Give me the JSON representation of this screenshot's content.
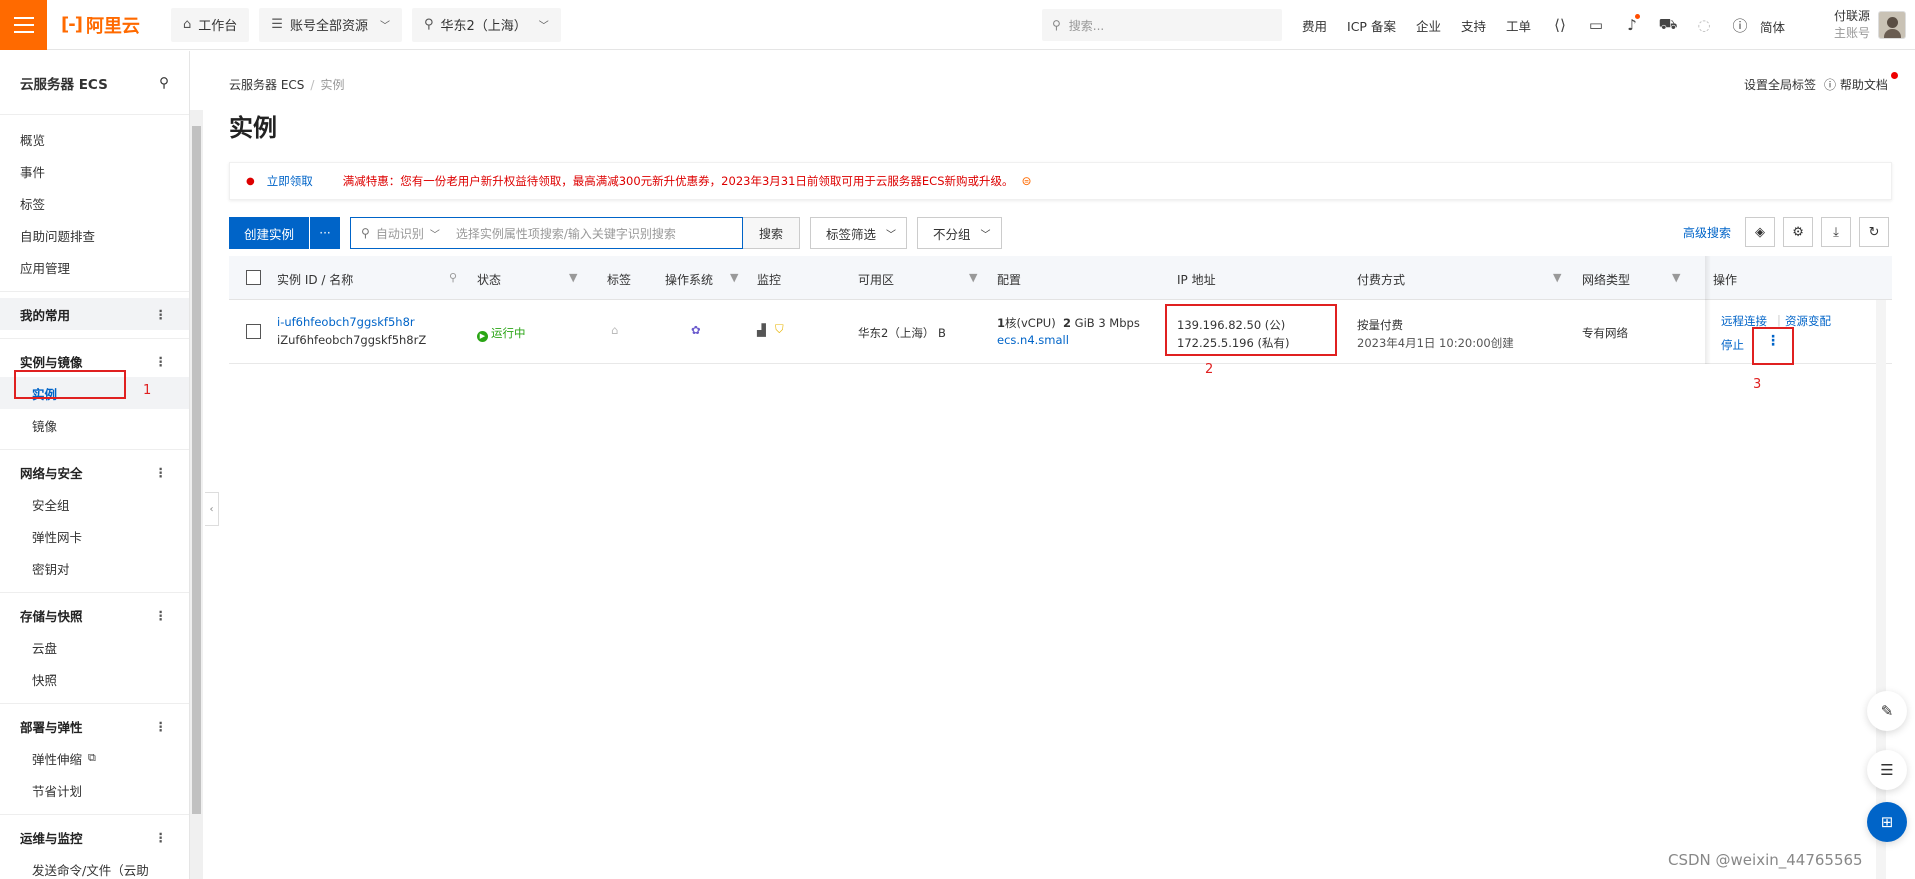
{
  "topbar": {
    "logo_mark": "[-]",
    "logo_text": "阿里云",
    "workbench": "工作台",
    "resources": "账号全部资源",
    "region": "华东2（上海）",
    "search_placeholder": "搜索...",
    "links": [
      "费用",
      "ICP 备案",
      "企业",
      "支持",
      "工单"
    ],
    "lang": "简体",
    "user_name": "付联源",
    "user_role": "主账号"
  },
  "sidebar": {
    "title": "云服务器 ECS",
    "top_items": [
      "概览",
      "事件",
      "标签",
      "自助问题排查",
      "应用管理"
    ],
    "favorites": "我的常用",
    "groups": [
      {
        "label": "实例与镜像",
        "items": [
          "实例",
          "镜像"
        ]
      },
      {
        "label": "网络与安全",
        "items": [
          "安全组",
          "弹性网卡",
          "密钥对"
        ]
      },
      {
        "label": "存储与快照",
        "items": [
          "云盘",
          "快照"
        ]
      },
      {
        "label": "部署与弹性",
        "items": [
          "弹性伸缩",
          "节省计划"
        ]
      },
      {
        "label": "运维与监控",
        "items": [
          "发送命令/文件（云助"
        ]
      }
    ]
  },
  "page": {
    "breadcrumb_root": "云服务器 ECS",
    "breadcrumb_current": "实例",
    "title": "实例",
    "global_tags": "设置全局标签",
    "help_docs": "帮助文档"
  },
  "banner": {
    "claim": "立即领取",
    "promo": "满减特惠：您有一份老用户新升权益待领取，最高满减300元新升优惠券，2023年3月31日前领取可用于云服务器ECS新购或升级。"
  },
  "toolbar": {
    "create": "创建实例",
    "more": "···",
    "auto_detect": "自动识别",
    "search_placeholder": "选择实例属性项搜索/输入关键字识别搜索",
    "search_btn": "搜索",
    "tag_filter": "标签筛选",
    "no_group": "不分组",
    "advanced": "高级搜索"
  },
  "table": {
    "headers": [
      "实例 ID / 名称",
      "状态",
      "标签",
      "操作系统",
      "监控",
      "可用区",
      "配置",
      "IP 地址",
      "付费方式",
      "网络类型",
      "操作"
    ],
    "row": {
      "id": "i-uf6hfeobch7ggskf5h8r",
      "name": "iZuf6hfeobch7ggskf5h8rZ",
      "status": "运行中",
      "zone": "华东2（上海） B",
      "cpu_num": "1",
      "cpu_unit": "核(vCPU)",
      "mem_num": "2",
      "mem_unit": "GiB 3 Mbps",
      "spec": "ecs.n4.small",
      "ip_public": "139.196.82.50 (公)",
      "ip_private": "172.25.5.196 (私有)",
      "billing": "按量付费",
      "created": "2023年4月1日 10:20:00创建",
      "network": "专有网络",
      "op_remote": "远程连接",
      "op_resize": "资源变配",
      "op_stop": "停止",
      "op_more": "⋮"
    }
  },
  "annotations": {
    "one": "1",
    "two": "2",
    "three": "3"
  },
  "watermark": "CSDN @weixin_44765565",
  "colors": {
    "brand": "#ff6a00",
    "primary": "#0064c8",
    "annotation": "#e02020",
    "running": "#2aa515"
  }
}
